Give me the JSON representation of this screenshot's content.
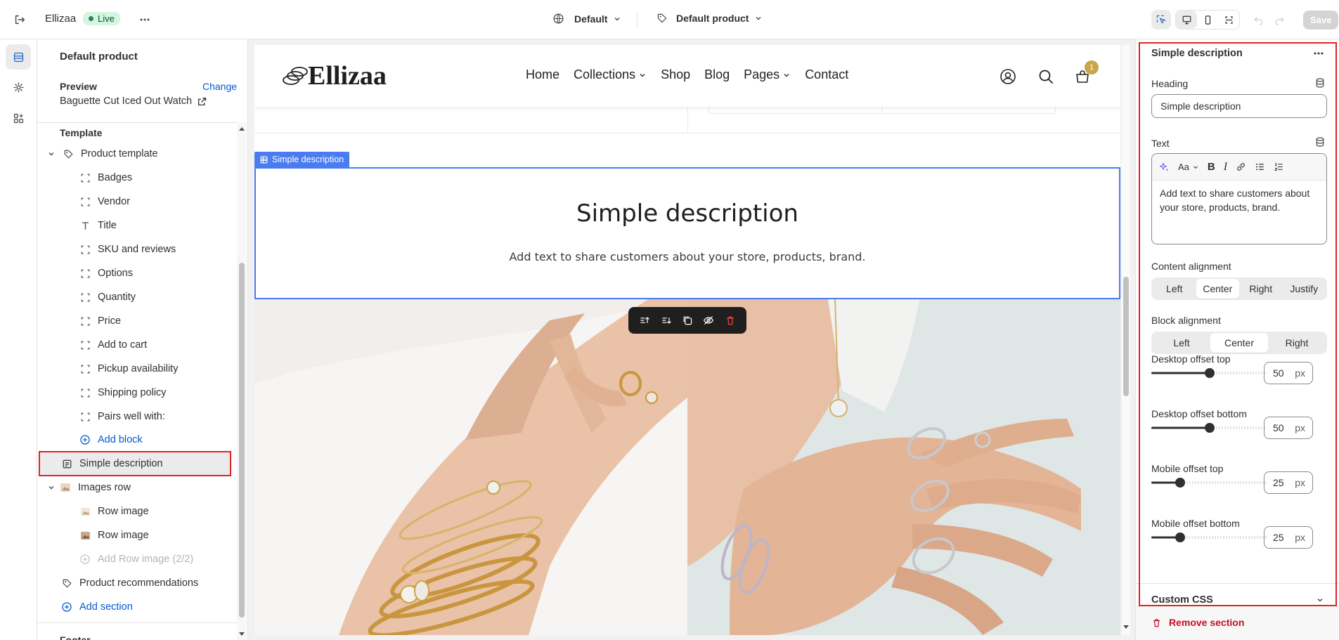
{
  "topbar": {
    "store_name": "Ellizaa",
    "status": "Live",
    "theme": "Default",
    "template": "Default product",
    "save_label": "Save"
  },
  "tree": {
    "title": "Default product",
    "preview_label": "Preview",
    "change_label": "Change",
    "preview_product": "Baguette Cut Iced Out Watch",
    "template_heading": "Template",
    "product_template": "Product template",
    "blocks": [
      "Badges",
      "Vendor",
      "Title",
      "SKU and reviews",
      "Options",
      "Quantity",
      "Price",
      "Add to cart",
      "Pickup availability",
      "Shipping policy",
      "Pairs well with:"
    ],
    "add_block": "Add block",
    "simple_description": "Simple description",
    "images_row": "Images row",
    "row_images": [
      "Row image",
      "Row image"
    ],
    "add_row_image": "Add Row image (2/2)",
    "product_recommendations": "Product recommendations",
    "add_section": "Add section",
    "footer_partial": "Footer"
  },
  "preview": {
    "logo": "Ellizaa",
    "nav": [
      "Home",
      "Collections",
      "Shop",
      "Blog",
      "Pages",
      "Contact"
    ],
    "cart_count": "1",
    "section_tag": "Simple description",
    "heading": "Simple description",
    "text": "Add text to share customers about your store, products, brand."
  },
  "settings": {
    "title": "Simple description",
    "heading_label": "Heading",
    "heading_value": "Simple description",
    "text_label": "Text",
    "text_value": "Add text to share customers about your store, products, brand.",
    "content_alignment_label": "Content alignment",
    "content_alignment_options": [
      "Left",
      "Center",
      "Right",
      "Justify"
    ],
    "content_alignment_selected": "Center",
    "block_alignment_label": "Block alignment",
    "block_alignment_options": [
      "Left",
      "Center",
      "Right"
    ],
    "block_alignment_selected": "Center",
    "offsets": [
      {
        "label": "Desktop offset top",
        "value": "50",
        "unit": "px",
        "fraction": 0.5
      },
      {
        "label": "Desktop offset bottom",
        "value": "50",
        "unit": "px",
        "fraction": 0.5
      },
      {
        "label": "Mobile offset top",
        "value": "25",
        "unit": "px",
        "fraction": 0.25
      },
      {
        "label": "Mobile offset bottom",
        "value": "25",
        "unit": "px",
        "fraction": 0.25
      }
    ],
    "custom_css_label": "Custom CSS",
    "remove_section": "Remove section"
  },
  "colors": {
    "accent": "#005bd3",
    "selection_blue": "#4a7cf0",
    "highlight_red": "#e02424",
    "badge_gold": "#c9a648",
    "danger": "#c70a24"
  }
}
